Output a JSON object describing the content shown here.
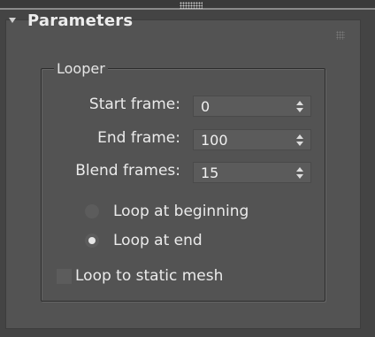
{
  "rollout": {
    "title": "Parameters",
    "collapse_icon": "triangle-down-icon",
    "grip_icon": "drag-grip-icon"
  },
  "looper": {
    "group_title": "Looper",
    "fields": [
      {
        "label": "Start frame:",
        "value": "0"
      },
      {
        "label": "End frame:",
        "value": "100"
      },
      {
        "label": "Blend frames:",
        "value": "15"
      }
    ],
    "loop_mode": {
      "options": [
        {
          "label": "Loop at beginning",
          "selected": false
        },
        {
          "label": "Loop at end",
          "selected": true
        }
      ]
    },
    "loop_to_static_mesh": {
      "label": "Loop to static mesh",
      "checked": false
    }
  },
  "colors": {
    "background": "#444444",
    "panel": "#535353",
    "field": "#5b5b5b",
    "text": "#e6e6e6"
  }
}
